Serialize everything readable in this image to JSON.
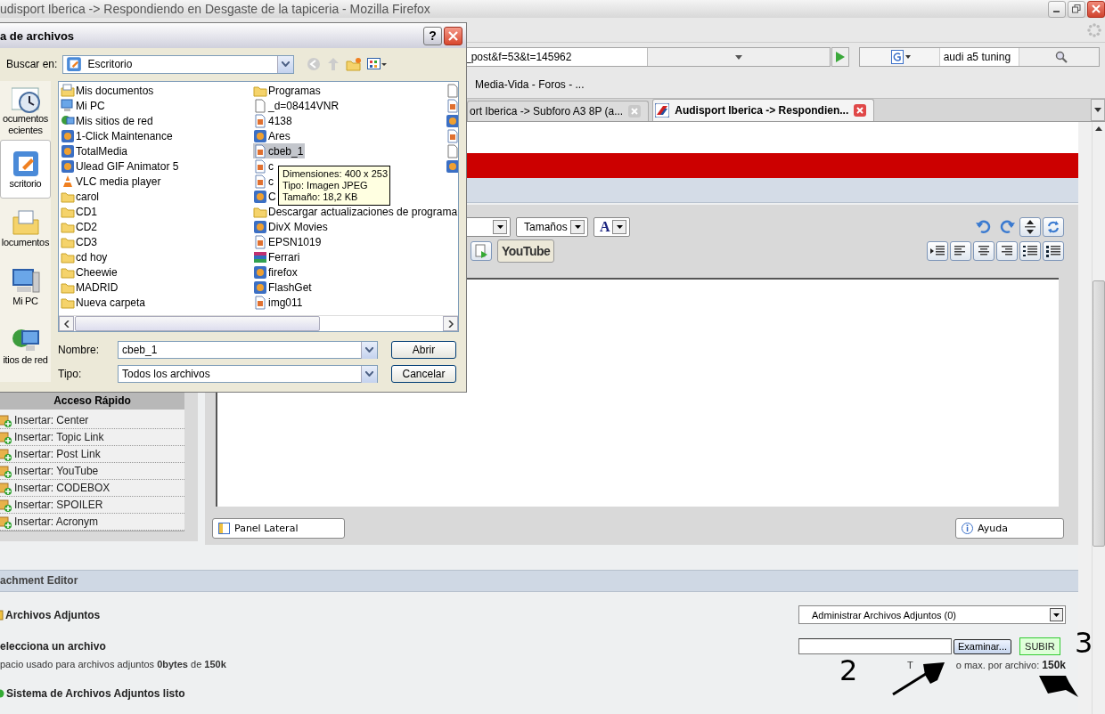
{
  "window": {
    "title": "udisport Iberica -> Respondiendo en Desgaste de la tapiceria - Mozilla Firefox"
  },
  "navigation": {
    "url": "_post&f=53&t=145962",
    "search": "audi a5 tuning"
  },
  "bookmarks": [
    "Media-Vida - Foros - ..."
  ],
  "tabs": [
    {
      "label": "ort Iberica -> Subforo A3 8P (a...",
      "selected": false
    },
    {
      "label": "Audisport Iberica -> Respondien...",
      "selected": true
    }
  ],
  "editor": {
    "size_select": "Tamaños",
    "color_select": "A",
    "youtube_button": "YouTube",
    "panel_button": "Panel Lateral",
    "help_button": "Ayuda"
  },
  "quick_access": {
    "title": "Acceso Rápido",
    "items": [
      "Insertar: Center",
      "Insertar: Topic Link",
      "Insertar: Post Link",
      "Insertar: YouTube",
      "Insertar: CODEBOX",
      "Insertar: SPOILER",
      "Insertar: Acronym"
    ]
  },
  "attachments": {
    "header": "achment Editor",
    "section_title": "Archivos Adjuntos",
    "manage_select": "Administrar Archivos Adjuntos (0)",
    "select_label": "elecciona un archivo",
    "browse_button": "Examinar...",
    "upload_button": "SUBIR",
    "usage": "pacio usado para archivos adjuntos **0bytes** de **150k**",
    "max_start": "T",
    "max_text": "o max. por archivo:",
    "max_value": "150k",
    "status": "Sistema de Archivos Adjuntos listo"
  },
  "annotations": [
    {
      "text": "2"
    },
    {
      "text": "3"
    }
  ],
  "dialog": {
    "title": "a de archivos",
    "help_button": "?",
    "look_in_label": "Buscar en:",
    "look_in": "Escritorio",
    "places": [
      {
        "label": "ocumentos\necientes",
        "kind": "recent",
        "selected": false
      },
      {
        "label": "scritorio",
        "kind": "desktop",
        "selected": true
      },
      {
        "label": "locumentos",
        "kind": "documents",
        "selected": false
      },
      {
        "label": "Mi PC",
        "kind": "computer",
        "selected": false
      },
      {
        "label": "itios de red",
        "kind": "network",
        "selected": false
      }
    ],
    "columns": [
      [
        {
          "name": "Mis documentos",
          "kind": "documents",
          "selected": false
        },
        {
          "name": "Mi PC",
          "kind": "computer",
          "selected": false
        },
        {
          "name": "Mis sitios de red",
          "kind": "network",
          "selected": false
        },
        {
          "name": "1-Click Maintenance",
          "kind": "app",
          "selected": false
        },
        {
          "name": "TotalMedia",
          "kind": "app",
          "selected": false
        },
        {
          "name": "Ulead GIF Animator 5",
          "kind": "app",
          "selected": false
        },
        {
          "name": "VLC media player",
          "kind": "cone",
          "selected": false
        },
        {
          "name": "carol",
          "kind": "folder",
          "selected": false
        },
        {
          "name": "CD1",
          "kind": "folder",
          "selected": false
        },
        {
          "name": "CD2",
          "kind": "folder",
          "selected": false
        },
        {
          "name": "CD3",
          "kind": "folder",
          "selected": false
        },
        {
          "name": "cd hoy",
          "kind": "folder",
          "selected": false
        },
        {
          "name": "Cheewie",
          "kind": "folder",
          "selected": false
        },
        {
          "name": "MADRID",
          "kind": "folder",
          "selected": false
        },
        {
          "name": "Nueva carpeta",
          "kind": "folder",
          "selected": false
        }
      ],
      [
        {
          "name": "Programas",
          "kind": "folder",
          "selected": false
        },
        {
          "name": "_d=08414VNR",
          "kind": "file",
          "selected": false
        },
        {
          "name": "4138",
          "kind": "image",
          "selected": false
        },
        {
          "name": "Ares",
          "kind": "app",
          "selected": false
        },
        {
          "name": "cbeb_1",
          "kind": "image",
          "selected": true
        },
        {
          "name": "c",
          "kind": "image",
          "selected": false
        },
        {
          "name": "c",
          "kind": "image",
          "selected": false
        },
        {
          "name": "C",
          "kind": "app",
          "selected": false
        },
        {
          "name": "Descargar actualizaciones de programa",
          "kind": "folder",
          "selected": false
        },
        {
          "name": "DivX Movies",
          "kind": "app",
          "selected": false
        },
        {
          "name": "EPSN1019",
          "kind": "image",
          "selected": false
        },
        {
          "name": "Ferrari",
          "kind": "archive",
          "selected": false
        },
        {
          "name": "firefox",
          "kind": "app",
          "selected": false
        },
        {
          "name": "FlashGet",
          "kind": "app",
          "selected": false
        },
        {
          "name": "img011",
          "kind": "image",
          "selected": false
        }
      ]
    ],
    "tooltip": [
      "Dimensiones: 400 x 253",
      "Tipo: Imagen JPEG",
      "Tamaño: 18,2 KB"
    ],
    "name_label": "Nombre:",
    "name_value": "cbeb_1",
    "type_label": "Tipo:",
    "type_value": "Todos los archivos",
    "open_button": "Abrir",
    "cancel_button": "Cancelar"
  }
}
